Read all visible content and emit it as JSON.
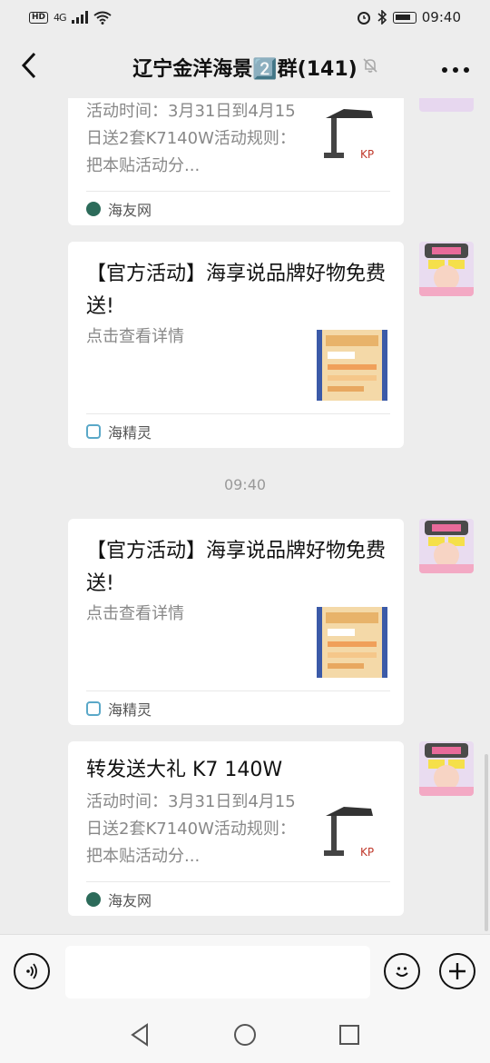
{
  "status_bar": {
    "left_badge": "HD",
    "network": "4G",
    "time": "09:40"
  },
  "header": {
    "back_icon": "chevron-left-icon",
    "title": "辽宁金洋海景2️⃣群(141)",
    "mute_icon": "bell-off-icon",
    "more_icon": "ellipsis-icon"
  },
  "messages": [
    {
      "type": "link-card",
      "title": "",
      "desc": "活动时间：3月31日到4月15日送2套K7140W活动规则：把本贴活动分...",
      "thumb_icon": "lamp-product-icon",
      "source": "海友网"
    },
    {
      "type": "link-card",
      "title": "【官方活动】海享说品牌好物免费送!",
      "desc": "点击查看详情",
      "thumb_icon": "poster-thumbnail-icon",
      "source": "海精灵"
    },
    {
      "type": "timestamp",
      "text": "09:40"
    },
    {
      "type": "link-card",
      "title": "【官方活动】海享说品牌好物免费送!",
      "desc": "点击查看详情",
      "thumb_icon": "poster-thumbnail-icon",
      "source": "海精灵"
    },
    {
      "type": "link-card",
      "title": "转发送大礼 K7 140W",
      "desc": "活动时间：3月31日到4月15日送2套K7140W活动规则：把本贴活动分...",
      "thumb_icon": "lamp-product-icon",
      "source": "海友网"
    }
  ],
  "input_bar": {
    "voice_icon": "voice-icon",
    "placeholder": "",
    "emoji_icon": "emoji-icon",
    "plus_icon": "plus-icon"
  },
  "system_nav": {
    "back": "triangle-back-icon",
    "home": "circle-home-icon",
    "recents": "square-recents-icon"
  },
  "colors": {
    "background": "#ededed",
    "card": "#ffffff",
    "secondary_text": "#888888"
  }
}
